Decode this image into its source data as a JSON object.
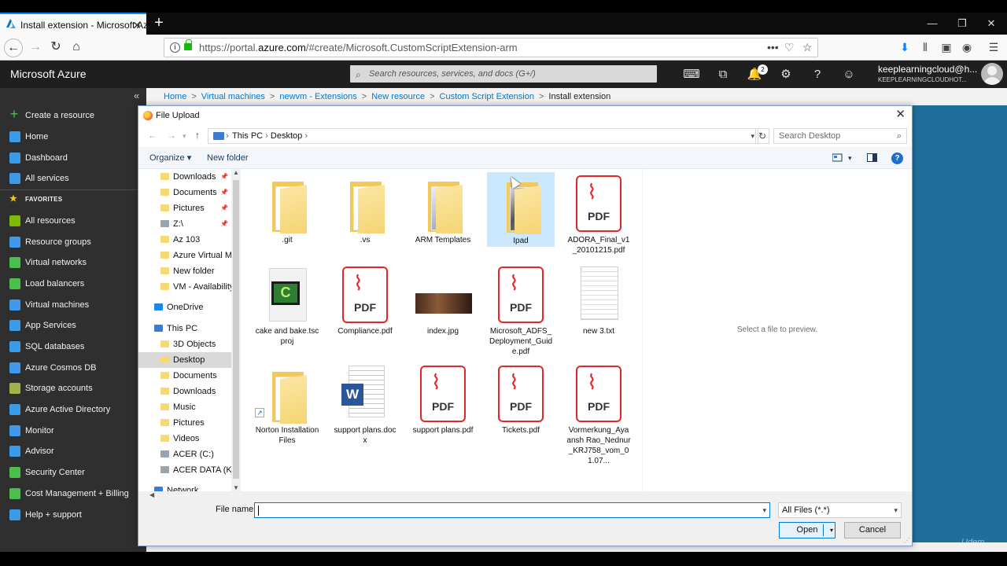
{
  "browser": {
    "tab_title": "Install extension - Microsoft Az",
    "new_tab_icon": "plus-icon",
    "url_prefix": "https://portal.",
    "url_host": "azure.com",
    "url_rest": "/#create/Microsoft.CustomScriptExtension-arm",
    "url_more": "•••",
    "accent_color": "#0a84ff"
  },
  "azure": {
    "brand": "Microsoft Azure",
    "search_placeholder": "Search resources, services, and docs (G+/)",
    "notification_count": "2",
    "user_name": "keeplearningcloud@h...",
    "user_tenant": "KEEPLEARNINGCLOUDHOT...",
    "collapse_glyph": "«"
  },
  "sidebar": {
    "items": [
      {
        "label": "Create a resource",
        "icon": "plus-icon",
        "color": "#4dbd4d"
      },
      {
        "label": "Home",
        "icon": "home-icon",
        "color": "#3b9be8"
      },
      {
        "label": "Dashboard",
        "icon": "dashboard-icon",
        "color": "#3b9be8"
      },
      {
        "label": "All services",
        "icon": "list-icon",
        "color": "#3b9be8"
      },
      {
        "label": "FAVORITES",
        "icon": "star-icon",
        "color": "#f2c811"
      },
      {
        "label": "All resources",
        "icon": "grid-icon",
        "color": "#7fba00"
      },
      {
        "label": "Resource groups",
        "icon": "cube-icon",
        "color": "#3b9be8"
      },
      {
        "label": "Virtual networks",
        "icon": "network-icon",
        "color": "#4dbd4d"
      },
      {
        "label": "Load balancers",
        "icon": "balancer-icon",
        "color": "#4dbd4d"
      },
      {
        "label": "Virtual machines",
        "icon": "vm-icon",
        "color": "#3b9be8"
      },
      {
        "label": "App Services",
        "icon": "globe-icon",
        "color": "#3b9be8"
      },
      {
        "label": "SQL databases",
        "icon": "sql-icon",
        "color": "#3b9be8"
      },
      {
        "label": "Azure Cosmos DB",
        "icon": "cosmos-icon",
        "color": "#3b9be8"
      },
      {
        "label": "Storage accounts",
        "icon": "storage-icon",
        "color": "#9fb54a"
      },
      {
        "label": "Azure Active Directory",
        "icon": "aad-icon",
        "color": "#3b9be8"
      },
      {
        "label": "Monitor",
        "icon": "monitor-icon",
        "color": "#3b9be8"
      },
      {
        "label": "Advisor",
        "icon": "advisor-icon",
        "color": "#3b9be8"
      },
      {
        "label": "Security Center",
        "icon": "shield-icon",
        "color": "#4dbd4d"
      },
      {
        "label": "Cost Management + Billing",
        "icon": "cost-icon",
        "color": "#4dbd4d"
      },
      {
        "label": "Help + support",
        "icon": "help-icon",
        "color": "#3b9be8"
      }
    ]
  },
  "breadcrumb": {
    "items": [
      "Home",
      "Virtual machines",
      "newvm - Extensions",
      "New resource",
      "Custom Script Extension"
    ],
    "current": "Install extension",
    "separator": ">"
  },
  "dialog": {
    "title": "File Upload",
    "close_glyph": "✕",
    "path": [
      "This PC",
      "Desktop"
    ],
    "search_placeholder": "Search Desktop",
    "organize_label": "Organize ▾",
    "new_folder_label": "New folder",
    "help_glyph": "?",
    "tree": [
      {
        "label": "Downloads",
        "pinned": true
      },
      {
        "label": "Documents",
        "pinned": true
      },
      {
        "label": "Pictures",
        "pinned": true
      },
      {
        "label": "Z:\\",
        "pinned": true
      },
      {
        "label": "Az 103",
        "pinned": false
      },
      {
        "label": "Azure Virtual Ma",
        "pinned": false
      },
      {
        "label": "New folder",
        "pinned": false
      },
      {
        "label": "VM - Availability",
        "pinned": false
      },
      {
        "label": "OneDrive",
        "pinned": false
      },
      {
        "label": "This PC",
        "pinned": false
      },
      {
        "label": "3D Objects",
        "pinned": false
      },
      {
        "label": "Desktop",
        "pinned": false,
        "selected": true
      },
      {
        "label": "Documents",
        "pinned": false
      },
      {
        "label": "Downloads",
        "pinned": false
      },
      {
        "label": "Music",
        "pinned": false
      },
      {
        "label": "Pictures",
        "pinned": false
      },
      {
        "label": "Videos",
        "pinned": false
      },
      {
        "label": "ACER (C:)",
        "pinned": false
      },
      {
        "label": "ACER DATA (K:)",
        "pinned": false
      },
      {
        "label": "Network",
        "pinned": false
      }
    ],
    "files": [
      {
        "name": ".git",
        "type": "folder"
      },
      {
        "name": ".vs",
        "type": "folder"
      },
      {
        "name": "ARM Templates",
        "type": "folder"
      },
      {
        "name": "Ipad",
        "type": "folder",
        "selected": true
      },
      {
        "name": "ADORA_Final_v1_20101215.pdf",
        "type": "pdf"
      },
      {
        "name": "cake and bake.tscproj",
        "type": "camtasia"
      },
      {
        "name": "Compliance.pdf",
        "type": "pdf"
      },
      {
        "name": "index.jpg",
        "type": "image"
      },
      {
        "name": "Microsoft_ADFS_Deployment_Guide.pdf",
        "type": "pdf"
      },
      {
        "name": "new 3.txt",
        "type": "text"
      },
      {
        "name": "Norton Installation Files",
        "type": "folder-shortcut"
      },
      {
        "name": "support plans.docx",
        "type": "word"
      },
      {
        "name": "support plans.pdf",
        "type": "pdf"
      },
      {
        "name": "Tickets.pdf",
        "type": "pdf"
      },
      {
        "name": "Vormerkung_Ayaansh Rao_Nednur_KRJ758_vom_01.07...",
        "type": "pdf"
      }
    ],
    "pdf_badge": "PDF",
    "word_badge": "W",
    "camtasia_badge": "C",
    "preview_text": "Select a file to preview.",
    "file_name_label": "File name:",
    "file_name_value": "",
    "file_type": "All Files (*.*)",
    "open_label": "Open",
    "cancel_label": "Cancel"
  },
  "watermark": "Udem"
}
